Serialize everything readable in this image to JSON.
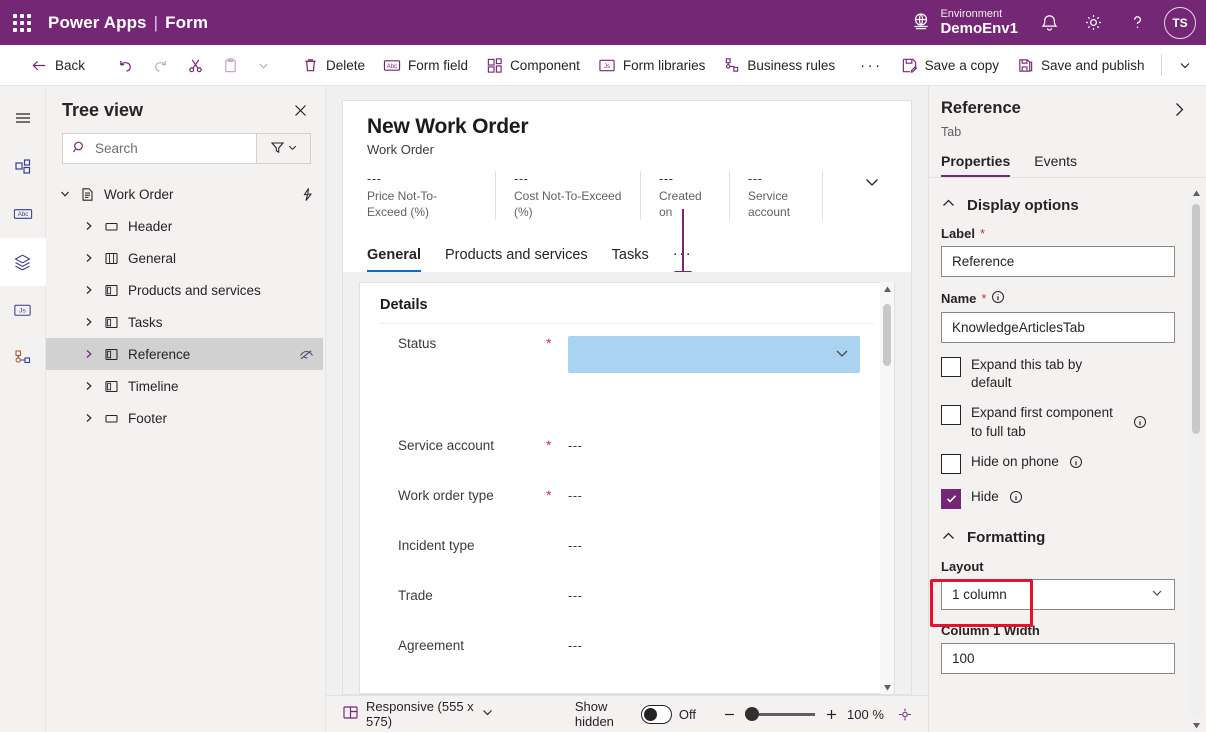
{
  "topbar": {
    "waffle_icon": "app-launcher-icon",
    "brand": "Power Apps",
    "brand_separator": "|",
    "page": "Form",
    "environment_label": "Environment",
    "environment_name": "DemoEnv1",
    "environment_icon": "globe-icon",
    "notifications_icon": "bell-icon",
    "settings_icon": "gear-icon",
    "help_icon": "question-icon",
    "avatar_initials": "TS",
    "brand_color": "#742774"
  },
  "commandbar": {
    "back": "Back",
    "undo_icon": "undo-icon",
    "redo_icon": "redo-icon",
    "cut_icon": "scissors-icon",
    "paste_icon": "clipboard-icon",
    "paste_more_icon": "chevron-down-icon",
    "delete": "Delete",
    "form_field": "Form field",
    "component": "Component",
    "form_libraries": "Form libraries",
    "business_rules": "Business rules",
    "overflow_icon": "ellipsis-icon",
    "save_a_copy": "Save a copy",
    "save_and_publish": "Save and publish",
    "save_more_icon": "chevron-down-icon"
  },
  "rail": {
    "items": [
      {
        "name": "menu-icon"
      },
      {
        "name": "components-icon"
      },
      {
        "name": "fields-abc-icon"
      },
      {
        "name": "layers-icon",
        "active": true
      },
      {
        "name": "javascript-icon"
      },
      {
        "name": "business-rules-icon"
      }
    ]
  },
  "treeview": {
    "title": "Tree view",
    "close_icon": "close-icon",
    "search_placeholder": "Search",
    "search_value": "",
    "search_icon": "search-icon",
    "filter_icon": "filter-icon",
    "filter_chevron_icon": "chevron-down-icon",
    "nodes": [
      {
        "label": "Work Order",
        "level": 0,
        "icon": "form-page-icon",
        "expanded": true,
        "trailing_icon": "flash-icon",
        "selected": false
      },
      {
        "label": "Header",
        "level": 1,
        "icon": "section-icon",
        "expanded": false,
        "selected": false
      },
      {
        "label": "General",
        "level": 1,
        "icon": "tab-columns-icon",
        "expanded": false,
        "selected": false
      },
      {
        "label": "Products and services",
        "level": 1,
        "icon": "tab-icon",
        "expanded": false,
        "selected": false
      },
      {
        "label": "Tasks",
        "level": 1,
        "icon": "tab-icon",
        "expanded": false,
        "selected": false
      },
      {
        "label": "Reference",
        "level": 1,
        "icon": "tab-icon",
        "expanded": false,
        "trailing_icon": "hidden-eye-icon",
        "selected": true
      },
      {
        "label": "Timeline",
        "level": 1,
        "icon": "tab-icon",
        "expanded": false,
        "selected": false
      },
      {
        "label": "Footer",
        "level": 1,
        "icon": "section-icon",
        "expanded": false,
        "selected": false
      }
    ]
  },
  "canvas": {
    "form_title": "New Work Order",
    "form_subtitle": "Work Order",
    "header_expand_icon": "chevron-down-icon",
    "header_fields": [
      {
        "value": "---",
        "label": "Price Not-To-Exceed (%)"
      },
      {
        "value": "---",
        "label": "Cost Not-To-Exceed (%)"
      },
      {
        "value": "---",
        "label": "Created on"
      },
      {
        "value": "---",
        "label": "Service account"
      }
    ],
    "tabs": [
      {
        "label": "General",
        "active": true
      },
      {
        "label": "Products and services",
        "active": false
      },
      {
        "label": "Tasks",
        "active": false
      }
    ],
    "tabs_overflow": "···",
    "drop_indicator_color": "#742774",
    "section_title": "Details",
    "fields": [
      {
        "label": "Status",
        "required": true,
        "type": "select",
        "value": "",
        "highlight_color": "#a9d3f0"
      },
      {
        "label": "Service account",
        "required": true,
        "type": "text",
        "value": "---"
      },
      {
        "label": "Work order type",
        "required": true,
        "type": "text",
        "value": "---"
      },
      {
        "label": "Incident type",
        "required": false,
        "type": "text",
        "value": "---"
      },
      {
        "label": "Trade",
        "required": false,
        "type": "text",
        "value": "---"
      },
      {
        "label": "Agreement",
        "required": false,
        "type": "text",
        "value": "---"
      }
    ]
  },
  "statusbar": {
    "layout_icon": "responsive-layout-icon",
    "layout_label": "Responsive (555 x 575)",
    "layout_chevron_icon": "chevron-down-icon",
    "show_hidden_label": "Show hidden",
    "show_hidden_state": "Off",
    "zoom_out_icon": "minus-icon",
    "zoom_in_icon": "plus-icon",
    "zoom_value": "100 %",
    "fit_icon": "fit-to-screen-icon"
  },
  "properties": {
    "title": "Reference",
    "subtitle": "Tab",
    "collapse_icon": "chevron-right-icon",
    "tabs": [
      {
        "label": "Properties",
        "active": true
      },
      {
        "label": "Events",
        "active": false
      }
    ],
    "display_options": {
      "section_title": "Display options",
      "chevron_icon": "chevron-up-icon",
      "label_field_label": "Label",
      "label_required": "*",
      "label_value": "Reference",
      "name_field_label": "Name",
      "name_required": "*",
      "name_info_icon": "info-icon",
      "name_value": "KnowledgeArticlesTab",
      "checkboxes": [
        {
          "label": "Expand this tab by default",
          "checked": false,
          "info": false
        },
        {
          "label": "Expand first component to full tab",
          "checked": false,
          "info": true
        },
        {
          "label": "Hide on phone",
          "checked": false,
          "info": true
        },
        {
          "label": "Hide",
          "checked": true,
          "info": true,
          "highlighted": true
        }
      ]
    },
    "formatting": {
      "section_title": "Formatting",
      "chevron_icon": "chevron-up-icon",
      "layout_label": "Layout",
      "layout_value": "1 column",
      "layout_chevron_icon": "chevron-down-icon",
      "column_width_label": "Column 1 Width",
      "column_width_value": "100"
    },
    "highlight_color": "#e8112d",
    "checkbox_accent": "#742774"
  }
}
